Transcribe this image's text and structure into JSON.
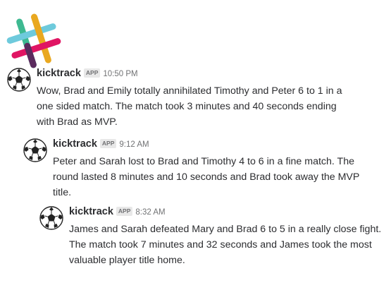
{
  "app": {
    "logo_icon": "slack-logo",
    "colors": {
      "teal": "#3eb991",
      "blue": "#6ecadc",
      "yellow": "#e9a820",
      "red": "#e01563",
      "purple": "#5b2b5e"
    }
  },
  "messages": [
    {
      "author": "kicktrack",
      "badge": "APP",
      "time": "10:50 PM",
      "avatar_icon": "soccer-ball-icon",
      "text": "Wow, Brad and Emily totally annihilated Timothy and Peter 6 to 1 in a one sided match. The match took 3 minutes and 40 seconds ending with Brad as MVP."
    },
    {
      "author": "kicktrack",
      "badge": "APP",
      "time": "9:12 AM",
      "avatar_icon": "soccer-ball-icon",
      "text": "Peter and Sarah lost to Brad and Timothy 4 to 6 in a fine match. The round lasted 8 minutes and 10 seconds and Brad took away the MVP title."
    },
    {
      "author": "kicktrack",
      "badge": "APP",
      "time": "8:32 AM",
      "avatar_icon": "soccer-ball-icon",
      "text": "James and Sarah defeated Mary and Brad 6 to 5 in a really close fight. The match took 7 minutes and 32 seconds and James took the most valuable player title home."
    }
  ]
}
